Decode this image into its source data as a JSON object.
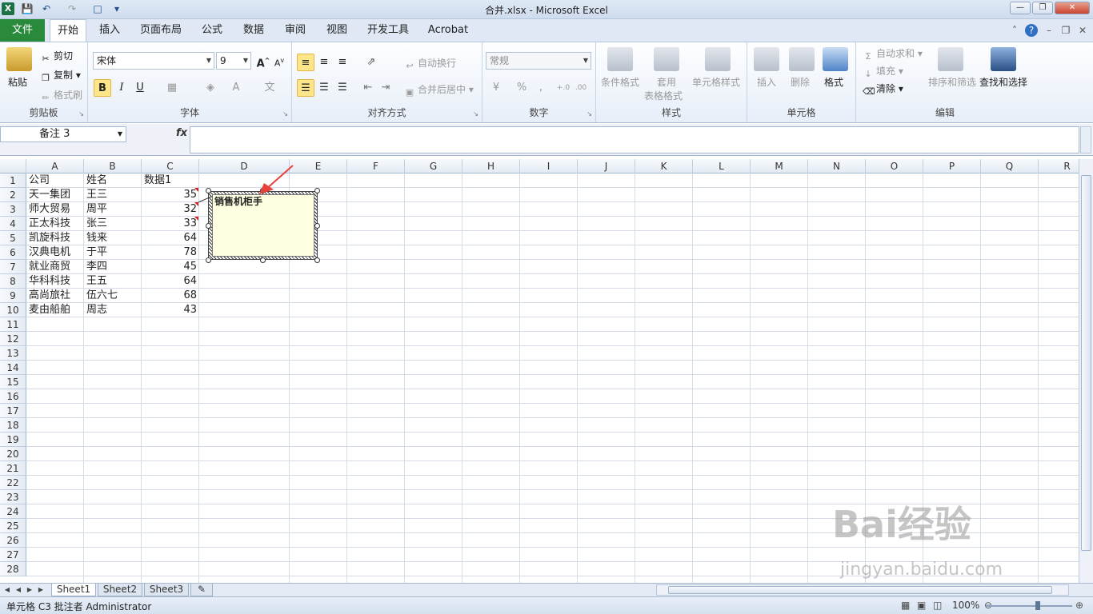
{
  "window": {
    "title": "合并.xlsx - Microsoft Excel",
    "icon": "excel-icon"
  },
  "quick_access": [
    "save-icon",
    "undo-icon",
    "redo-icon",
    "print-preview-icon",
    "customize-icon"
  ],
  "tabs": [
    "文件",
    "开始",
    "插入",
    "页面布局",
    "公式",
    "数据",
    "审阅",
    "视图",
    "开发工具",
    "Acrobat"
  ],
  "active_tab": "开始",
  "ribbon": {
    "clipboard": {
      "label": "剪贴板",
      "paste": "粘贴",
      "cut": "剪切",
      "copy": "复制",
      "format_painter": "格式刷"
    },
    "font": {
      "label": "字体",
      "name": "宋体",
      "size": "9",
      "bold": "B",
      "italic": "I",
      "underline": "U"
    },
    "alignment": {
      "label": "对齐方式",
      "wrap": "自动换行",
      "merge": "合并后居中"
    },
    "number": {
      "label": "数字",
      "format": "常规",
      "percent": "%",
      "comma": ","
    },
    "styles": {
      "label": "样式",
      "conditional": "条件格式",
      "table_style_1": "套用",
      "table_style_2": "表格格式",
      "cell_style": "单元格样式"
    },
    "cells": {
      "label": "单元格",
      "insert": "插入",
      "delete": "删除",
      "format": "格式"
    },
    "editing": {
      "label": "编辑",
      "autosum": "自动求和",
      "fill": "填充",
      "clear": "清除",
      "sort": "排序和筛选",
      "find": "查找和选择"
    }
  },
  "formula_bar": {
    "name_box": "备注 3",
    "fx": "fx",
    "content": ""
  },
  "columns": [
    "A",
    "B",
    "C",
    "D",
    "E",
    "F",
    "G",
    "H",
    "I",
    "J",
    "K",
    "L",
    "M",
    "N",
    "O",
    "P",
    "Q",
    "R"
  ],
  "rows": [
    "1",
    "2",
    "3",
    "4",
    "5",
    "6",
    "7",
    "8",
    "9",
    "10",
    "11",
    "12",
    "13",
    "14",
    "15",
    "16",
    "17",
    "18",
    "19",
    "20",
    "21",
    "22",
    "23",
    "24",
    "25",
    "26",
    "27",
    "28"
  ],
  "table": {
    "headers": [
      "公司",
      "姓名",
      "数据1"
    ],
    "data": [
      [
        "天一集团",
        "王三",
        "35"
      ],
      [
        "师大贸易",
        "周平",
        "32"
      ],
      [
        "正太科技",
        "张三",
        "33"
      ],
      [
        "凯旋科技",
        "钱来",
        "64"
      ],
      [
        "汉典电机",
        "于平",
        "78"
      ],
      [
        "就业商贸",
        "李四",
        "45"
      ],
      [
        "华科科技",
        "王五",
        "64"
      ],
      [
        "高尚旅社",
        "伍六七",
        "68"
      ],
      [
        "麦由船舶",
        "周志",
        "43"
      ]
    ]
  },
  "comment": {
    "text": "销售机柜手"
  },
  "sheets": [
    "Sheet1",
    "Sheet2",
    "Sheet3"
  ],
  "active_sheet": "Sheet1",
  "status": {
    "text": "单元格 C3 批注者 Administrator",
    "zoom": "100%"
  },
  "watermark": {
    "main": "Bai经验",
    "sub": "jingyan.baidu.com"
  },
  "colors": {
    "accent_green": "#2a8a3c",
    "ribbon_bg": "#e7eef8",
    "comment_bg": "#ffffe1",
    "arrow": "#e8403a"
  }
}
